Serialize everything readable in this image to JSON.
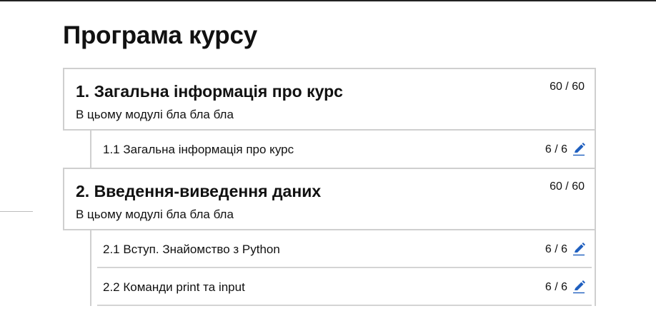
{
  "page": {
    "title": "Програма курсу"
  },
  "modules": [
    {
      "title": "1. Загальна інформація про курс",
      "description": "В цьому модулі бла бла бла",
      "score": "60 / 60",
      "lessons": [
        {
          "title": "1.1 Загальна інформація про курс",
          "score": "6 / 6",
          "icon": "pencil-edit-icon"
        }
      ]
    },
    {
      "title": "2. Введення-виведення даних",
      "description": "В цьому модулі бла бла бла",
      "score": "60 / 60",
      "lessons": [
        {
          "title": "2.1 Вступ. Знайомство з Python",
          "score": "6 / 6",
          "icon": "pencil-edit-icon"
        },
        {
          "title": "2.2 Команди print та input",
          "score": "6 / 6",
          "icon": "pencil-edit-icon"
        }
      ]
    }
  ],
  "colors": {
    "border": "#cfcfcf",
    "icon": "#1f5fbf"
  }
}
